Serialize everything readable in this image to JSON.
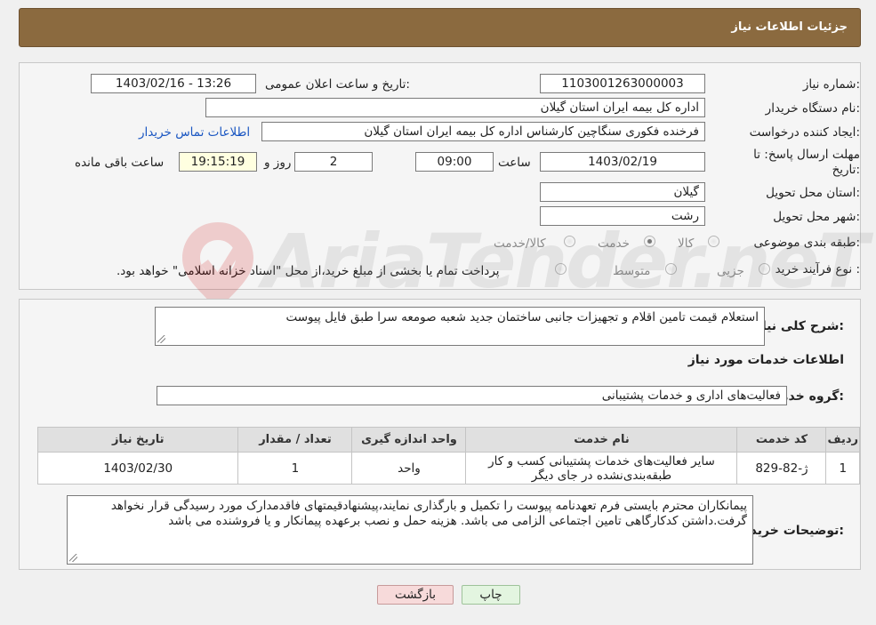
{
  "header": {
    "title": "جزئیات اطلاعات نیاز"
  },
  "form": {
    "need_number": {
      "label": "شماره نیاز:",
      "value": "1103001263000003"
    },
    "announce_datetime": {
      "label": "تاریخ و ساعت اعلان عمومی:",
      "value": "1403/02/16 - 13:26"
    },
    "buyer_org": {
      "label": "نام دستگاه خریدار:",
      "value": "اداره کل بیمه ایران استان گیلان"
    },
    "requester": {
      "label": "ایجاد کننده درخواست:",
      "value": "فرخنده فکوری سنگاچین کارشناس اداره کل بیمه ایران استان گیلان",
      "contact_link": "اطلاعات تماس خریدار"
    },
    "deadline": {
      "label_line1": "مهلت ارسال پاسخ: تا",
      "label_line2": "تاریخ:",
      "date": "1403/02/19",
      "time_label": "ساعت",
      "time": "09:00",
      "days": "2",
      "days_label": "روز و",
      "remaining": "19:15:19",
      "remaining_label": "ساعت باقی مانده"
    },
    "delivery_province": {
      "label": "استان محل تحویل:",
      "value": "گیلان"
    },
    "delivery_city": {
      "label": "شهر محل تحویل:",
      "value": "رشت"
    },
    "category": {
      "label": "طبقه بندی موضوعی:",
      "options": [
        {
          "label": "کالا",
          "checked": false
        },
        {
          "label": "خدمت",
          "checked": true
        },
        {
          "label": "کالا/خدمت",
          "checked": false
        }
      ]
    },
    "purchase_type": {
      "label": "نوع فرآیند خرید :",
      "options": [
        {
          "label": "جزیی",
          "checked": false
        },
        {
          "label": "متوسط",
          "checked": false
        },
        {
          "label": "پرداخت تمام یا بخشی از مبلغ خرید،از محل \"اسناد خزانه اسلامی\" خواهد بود.",
          "checked": false
        }
      ]
    }
  },
  "details": {
    "summary_label": "شرح کلی نیاز:",
    "summary_value": "استعلام قیمت تامین اقلام و تجهیزات جانبی ساختمان جدید شعبه صومعه سرا طبق فایل پیوست",
    "services_heading": "اطلاعات خدمات مورد نیاز",
    "service_group_label": "گروه خدمت:",
    "service_group_value": "فعالیت‌های اداری و خدمات پشتیبانی",
    "table": {
      "headers": [
        "ردیف",
        "کد خدمت",
        "نام خدمت",
        "واحد اندازه گیری",
        "تعداد / مقدار",
        "تاریخ نیاز"
      ],
      "rows": [
        [
          "1",
          "ژ-82-829",
          "سایر فعالیت‌های خدمات پشتیبانی کسب و کار طبقه‌بندی‌نشده در جای دیگر",
          "واحد",
          "1",
          "1403/02/30"
        ]
      ]
    },
    "buyer_notes_label": "توضیحات خریدار:",
    "buyer_notes_value": "پیمانکاران محترم بایستی فرم تعهدنامه پیوست را تکمیل و بارگذاری نمایند،پیشنهادقیمتهای فاقدمدارک مورد رسیدگی قرار نخواهد گرفت.داشتن کدکارگاهی تامین اجتماعی الزامی می باشد. هزینه حمل و نصب برعهده پیمانکار و یا فروشنده می باشد"
  },
  "buttons": {
    "print": "چاپ",
    "back": "بازگشت"
  },
  "watermark": {
    "text": "AriaTender.neT"
  }
}
